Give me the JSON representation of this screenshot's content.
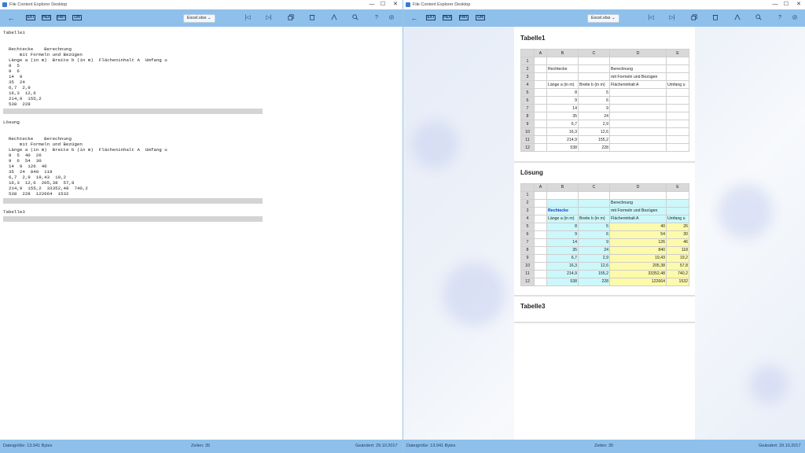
{
  "app_title": "File Content Explorer Desktop",
  "window_controls": {
    "min": "—",
    "max": "☐",
    "close": "✕"
  },
  "toolbar": {
    "back": "←",
    "modes": [
      "EXT",
      "HEX",
      "FMT",
      "LIN"
    ],
    "file_dropdown": "Excel.xlsx ⌄",
    "nav_icons": [
      "|◁",
      "▷|"
    ]
  },
  "status": {
    "size": "Dateigröße: 13.941 Bytes",
    "lines": "Zeilen: 35",
    "changed": "Geändert: 29.10.2017"
  },
  "plain_view": {
    "lines": [
      "Tabelle1",
      "",
      "",
      "  Rechtecke    Berechnung",
      "      mit Formeln und Bezügen",
      "  Länge a (in m)  Breite b (in m)  Flächeninhalt A  Umfang u",
      "  8  5",
      "  9  6",
      "  14  9",
      "  35  24",
      "  6,7  2,9",
      "  16,3  12,6",
      "  214,9  155,2",
      "  538  228",
      "",
      "",
      "Lösung",
      "",
      "",
      "  Rechtecke    Berechnung",
      "      mit Formeln und Bezügen",
      "  Länge a (in m)  Breite b (in m)  Flächeninhalt A  Umfang u",
      "  8  5  40  26",
      "  9  6  54  30",
      "  14  9  126  46",
      "  35  24  840  118",
      "  6,7  2,9  19,43  19,2",
      "  16,3  12,6  205,38  57,8",
      "  214,9  155,2  33352,48  740,2",
      "  538  228  122664  1532",
      "",
      "",
      "Tabelle3"
    ]
  },
  "formatted_view": {
    "columns": [
      "",
      "A",
      "B",
      "C",
      "D",
      "E"
    ],
    "sheets": [
      {
        "title": "Tabelle1",
        "rows": [
          [
            "1",
            "",
            "",
            "",
            "",
            ""
          ],
          [
            "2",
            "",
            "Rechtecke",
            "",
            "Berechnung",
            ""
          ],
          [
            "3",
            "",
            "",
            "",
            "mit Formeln und Bezügen",
            ""
          ],
          [
            "4",
            "",
            "Länge a (in m)",
            "Breite b (in m)",
            "Flächeninhalt A",
            "Umfang u"
          ],
          [
            "5",
            "",
            "8",
            "5",
            "",
            ""
          ],
          [
            "6",
            "",
            "9",
            "6",
            "",
            ""
          ],
          [
            "7",
            "",
            "14",
            "9",
            "",
            ""
          ],
          [
            "8",
            "",
            "35",
            "24",
            "",
            ""
          ],
          [
            "9",
            "",
            "6,7",
            "2,9",
            "",
            ""
          ],
          [
            "10",
            "",
            "16,3",
            "12,6",
            "",
            ""
          ],
          [
            "11",
            "",
            "214,9",
            "155,2",
            "",
            ""
          ],
          [
            "12",
            "",
            "538",
            "228",
            "",
            ""
          ]
        ]
      },
      {
        "title": "Lösung",
        "rows": [
          [
            "1",
            "",
            "",
            "",
            "",
            ""
          ],
          [
            "2",
            "",
            "",
            "",
            "Berechnung",
            ""
          ],
          [
            "3",
            "",
            "Rechtecke",
            "",
            "mit Formeln und Bezügen",
            ""
          ],
          [
            "4",
            "",
            "Länge a (in m)",
            "Breite b (in m)",
            "Flächeninhalt A",
            "Umfang u"
          ],
          [
            "5",
            "",
            "8",
            "5",
            "40",
            "26"
          ],
          [
            "6",
            "",
            "9",
            "6",
            "54",
            "30"
          ],
          [
            "7",
            "",
            "14",
            "9",
            "126",
            "46"
          ],
          [
            "8",
            "",
            "35",
            "24",
            "840",
            "118"
          ],
          [
            "9",
            "",
            "6,7",
            "2,9",
            "19,43",
            "19,2"
          ],
          [
            "10",
            "",
            "16,3",
            "12,6",
            "205,38",
            "57,8"
          ],
          [
            "11",
            "",
            "214,9",
            "155,2",
            "33352,48",
            "740,2"
          ],
          [
            "12",
            "",
            "538",
            "228",
            "122664",
            "1532"
          ]
        ]
      },
      {
        "title": "Tabelle3",
        "rows": []
      }
    ]
  }
}
